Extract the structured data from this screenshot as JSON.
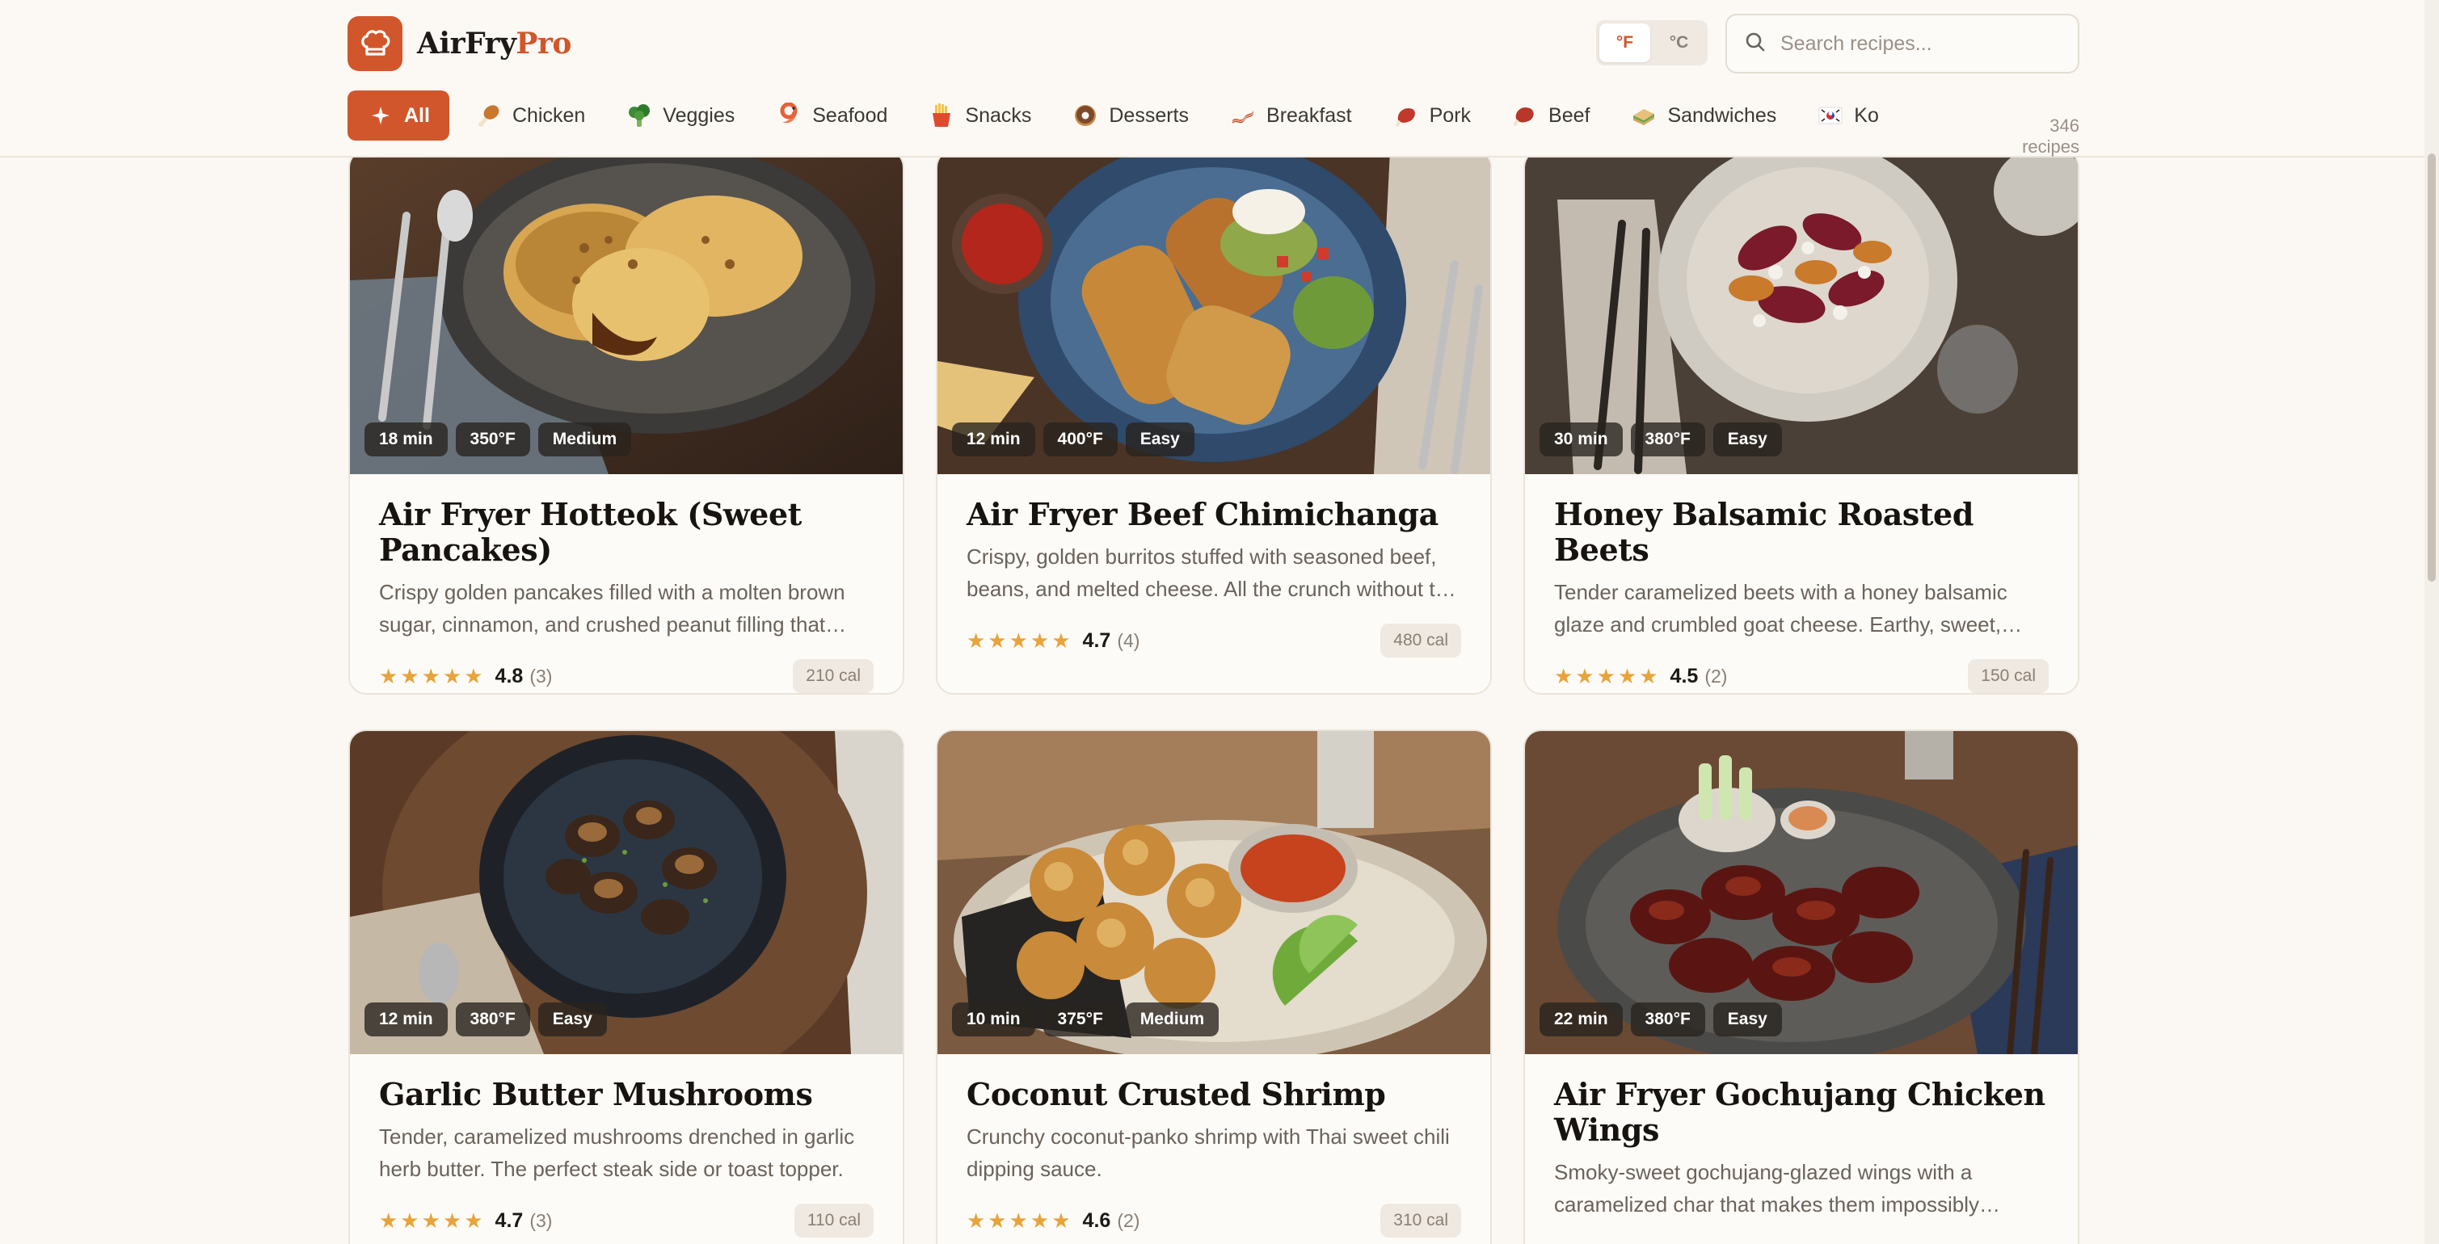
{
  "app": {
    "name_part1": "AirFry",
    "name_part2": "Pro"
  },
  "unit_toggle": {
    "fahrenheit": "°F",
    "celsius": "°C",
    "selected": "°F"
  },
  "search": {
    "placeholder": "Search recipes..."
  },
  "categories": [
    {
      "label": "All",
      "icon": "sparkle-icon",
      "active": true
    },
    {
      "label": "Chicken",
      "icon": "drumstick-icon"
    },
    {
      "label": "Veggies",
      "icon": "broccoli-icon"
    },
    {
      "label": "Seafood",
      "icon": "shrimp-icon"
    },
    {
      "label": "Snacks",
      "icon": "fries-icon"
    },
    {
      "label": "Desserts",
      "icon": "donut-icon"
    },
    {
      "label": "Breakfast",
      "icon": "bacon-icon"
    },
    {
      "label": "Pork",
      "icon": "pork-icon"
    },
    {
      "label": "Beef",
      "icon": "steak-icon"
    },
    {
      "label": "Sandwiches",
      "icon": "sandwich-icon"
    },
    {
      "label": "Ko",
      "icon": "korea-flag-icon"
    }
  ],
  "recipe_count": "346 recipes",
  "recipes": [
    {
      "time": "18 min",
      "temp": "350°F",
      "difficulty": "Medium",
      "title": "Air Fryer Hotteok (Sweet Pancakes)",
      "description": "Crispy golden pancakes filled with a molten brown sugar, cinnamon, and crushed peanut filling that oozes out when you bite in.",
      "rating": "4.8",
      "rating_count": "(3)",
      "stars": 5,
      "calories": "210 cal"
    },
    {
      "time": "12 min",
      "temp": "400°F",
      "difficulty": "Easy",
      "title": "Air Fryer Beef Chimichanga",
      "description": "Crispy, golden burritos stuffed with seasoned beef, beans, and melted cheese. All the crunch without the deep fryer.",
      "rating": "4.7",
      "rating_count": "(4)",
      "stars": 4.5,
      "calories": "480 cal"
    },
    {
      "time": "30 min",
      "temp": "380°F",
      "difficulty": "Easy",
      "title": "Honey Balsamic Roasted Beets",
      "description": "Tender caramelized beets with a honey balsamic glaze and crumbled goat cheese. Earthy, sweet, tangy and delicious.",
      "rating": "4.5",
      "rating_count": "(2)",
      "stars": 4.5,
      "calories": "150 cal"
    },
    {
      "time": "12 min",
      "temp": "380°F",
      "difficulty": "Easy",
      "title": "Garlic Butter Mushrooms",
      "description": "Tender, caramelized mushrooms drenched in garlic herb butter. The perfect steak side or toast topper.",
      "rating": "4.7",
      "rating_count": "(3)",
      "stars": 4.5,
      "calories": "110 cal"
    },
    {
      "time": "10 min",
      "temp": "375°F",
      "difficulty": "Medium",
      "title": "Coconut Crusted Shrimp",
      "description": "Crunchy coconut-panko shrimp with Thai sweet chili dipping sauce.",
      "rating": "4.6",
      "rating_count": "(2)",
      "stars": 4.5,
      "calories": "310 cal"
    },
    {
      "time": "22 min",
      "temp": "380°F",
      "difficulty": "Easy",
      "title": "Air Fryer Gochujang Chicken Wings",
      "description": "Smoky-sweet gochujang-glazed wings with a caramelized char that makes them impossibly addictive.",
      "rating": "",
      "rating_count": "",
      "stars": 0,
      "calories": ""
    }
  ],
  "colors": {
    "accent": "#d2562b",
    "star": "#e8a33a",
    "background": "#fbf8f3"
  }
}
